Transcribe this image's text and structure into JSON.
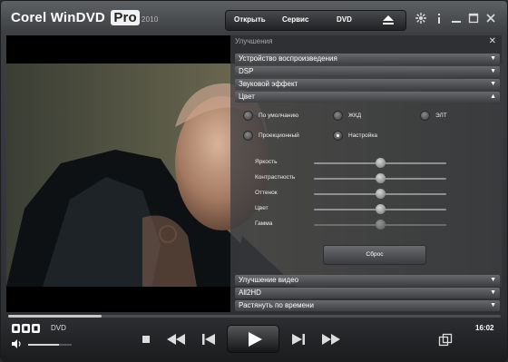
{
  "app": {
    "name": "Corel WinDVD",
    "edition": "Pro",
    "year": "2010"
  },
  "menu": {
    "open": "Открыть",
    "service": "Сервис",
    "dvd": "DVD"
  },
  "panel": {
    "title": "Улучшения",
    "sections_top": [
      {
        "label": "Устройство воспроизведения",
        "expanded": false
      },
      {
        "label": "DSP",
        "expanded": false
      },
      {
        "label": "Звуковой эффект",
        "expanded": false
      },
      {
        "label": "Цвет",
        "expanded": true
      }
    ],
    "color_modes": [
      {
        "label": "По умолчанию",
        "selected": false
      },
      {
        "label": "ЖКД",
        "selected": false
      },
      {
        "label": "ЭЛТ",
        "selected": false
      },
      {
        "label": "Проекционный",
        "selected": false
      },
      {
        "label": "Настройка",
        "selected": true
      }
    ],
    "sliders": [
      {
        "label": "Яркость",
        "value": 0.5
      },
      {
        "label": "Контрастность",
        "value": 0.5
      },
      {
        "label": "Оттенок",
        "value": 0.5
      },
      {
        "label": "Цвет",
        "value": 0.5
      },
      {
        "label": "Гамма",
        "value": 0.5
      }
    ],
    "reset_label": "Сброс",
    "sections_bottom": [
      {
        "label": "Улучшение видео",
        "expanded": false
      },
      {
        "label": "All2HD",
        "expanded": false
      },
      {
        "label": "Растянуть по времени",
        "expanded": false
      }
    ]
  },
  "player": {
    "source": "DVD",
    "time": "16:02",
    "progress": 0.19,
    "volume": 0.7
  },
  "colors": {
    "accent": "#ffffff",
    "panel_bg": "#3c3e41"
  },
  "icons": [
    "settings-icon",
    "info-icon",
    "minimize-icon",
    "restore-icon",
    "close-icon",
    "eject-icon",
    "stop-icon",
    "rewind-icon",
    "prev-chapter-icon",
    "play-icon",
    "next-chapter-icon",
    "fast-forward-icon",
    "volume-icon",
    "screen-mode-icon"
  ]
}
